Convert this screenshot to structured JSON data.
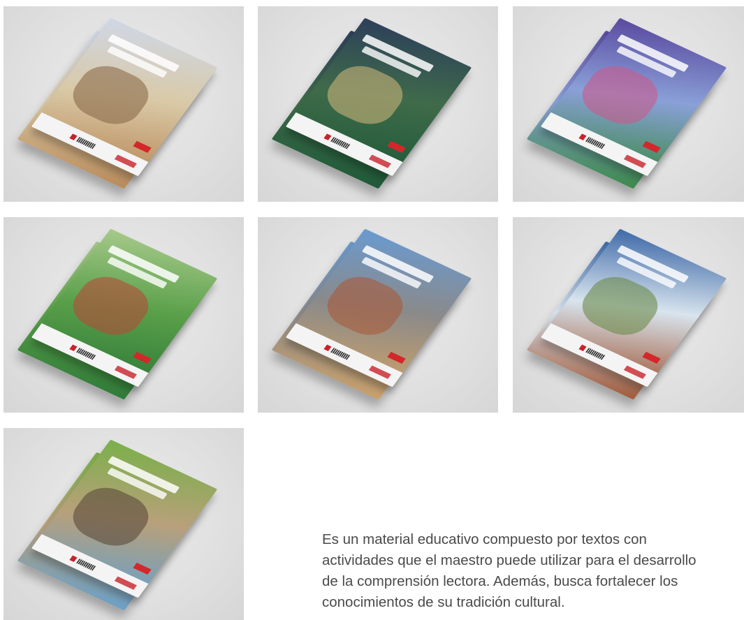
{
  "gallery": {
    "items": [
      {
        "name": "book-cover-1",
        "cover_top": "#cfd7e6",
        "cover_mid": "#d9c9a6",
        "cover_bottom": "#b98a5a",
        "scene": "#8a6a4a"
      },
      {
        "name": "book-cover-2",
        "cover_top": "#2d3f5a",
        "cover_mid": "#3f6b4a",
        "cover_bottom": "#1f5a38",
        "scene": "#c9b27a"
      },
      {
        "name": "book-cover-3",
        "cover_top": "#5a4aa0",
        "cover_mid": "#8aa0d8",
        "cover_bottom": "#3c8a4a",
        "scene": "#c95a8a"
      },
      {
        "name": "book-cover-4",
        "cover_top": "#a6c98a",
        "cover_mid": "#5aa04a",
        "cover_bottom": "#2f7a38",
        "scene": "#b84a3a"
      },
      {
        "name": "book-cover-5",
        "cover_top": "#6a9ad0",
        "cover_mid": "#8a8a8a",
        "cover_bottom": "#c9a06a",
        "scene": "#a85a3a"
      },
      {
        "name": "book-cover-6",
        "cover_top": "#3f6aa8",
        "cover_mid": "#d8e4ee",
        "cover_bottom": "#a05a3a",
        "scene": "#6a8a4a"
      },
      {
        "name": "book-cover-7",
        "cover_top": "#7ab04a",
        "cover_mid": "#b8a07a",
        "cover_bottom": "#6aa0c8",
        "scene": "#5a4a3a"
      }
    ]
  },
  "description": {
    "text": "Es un material educativo compuesto por textos con actividades que el maestro puede utilizar para el desarrollo de la comprensión lectora. Además, busca fortalecer los conocimientos de su tradición cultural."
  }
}
